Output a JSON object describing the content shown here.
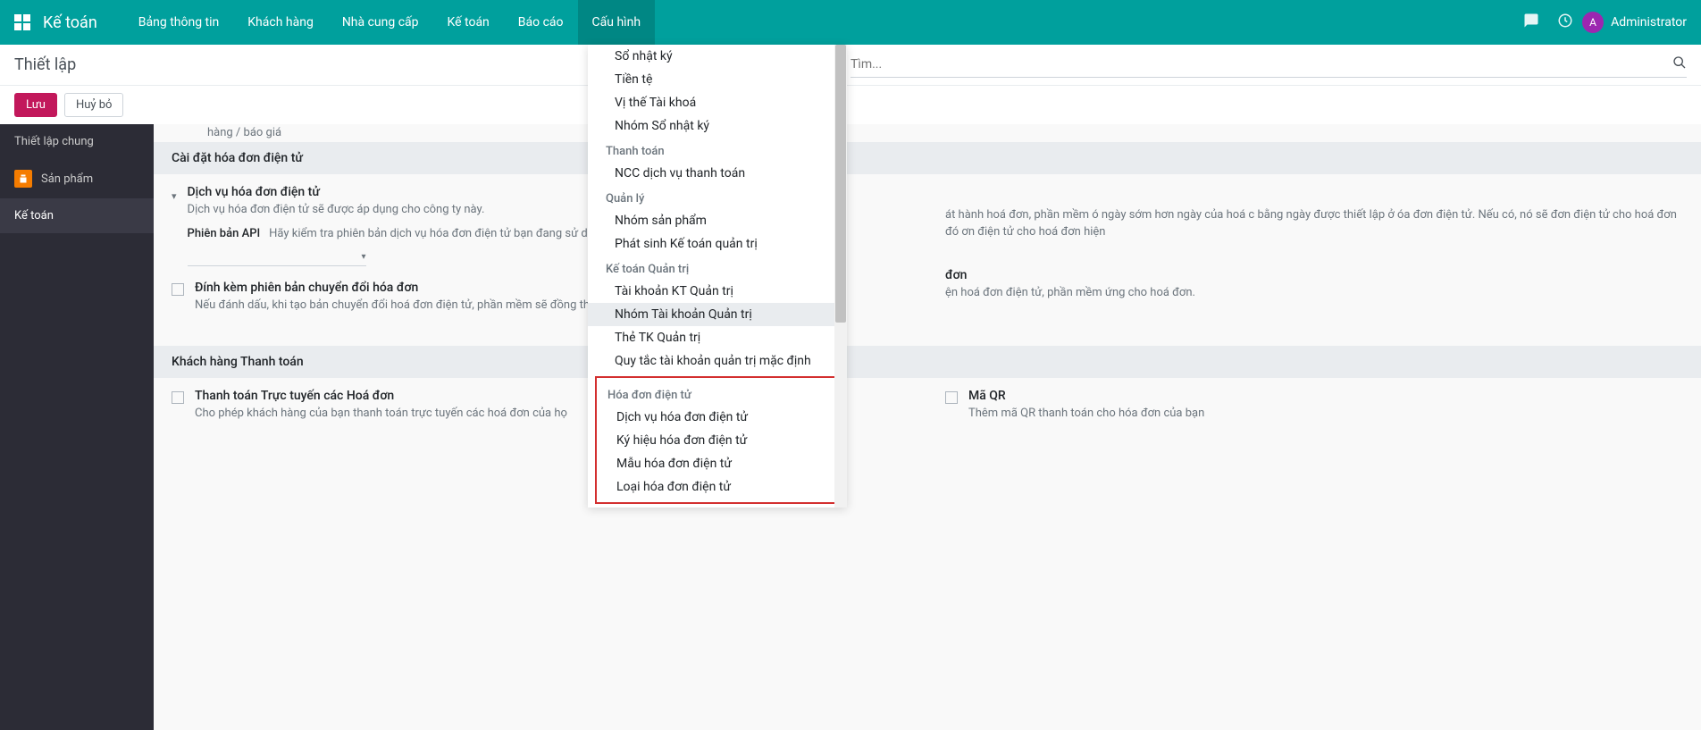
{
  "topbar": {
    "app_name": "Kế toán",
    "nav": [
      "Bảng thông tin",
      "Khách hàng",
      "Nhà cung cấp",
      "Kế toán",
      "Báo cáo",
      "Cấu hình"
    ],
    "user_initial": "A",
    "user_name": "Administrator"
  },
  "page": {
    "title": "Thiết lập",
    "search_placeholder": "Tìm...",
    "save_label": "Lưu",
    "discard_label": "Huỷ bỏ"
  },
  "sidebar": {
    "items": [
      {
        "label": "Thiết lập chung",
        "icon": ""
      },
      {
        "label": "Sản phẩm",
        "icon": "$"
      },
      {
        "label": "Kế toán",
        "icon": ""
      }
    ]
  },
  "content": {
    "truncated_top": "hàng / báo giá",
    "section1_title": "Cài đặt hóa đơn điện tử",
    "service_label": "Dịch vụ hóa đơn điện tử",
    "service_desc": "Dịch vụ hóa đơn điện tử sẽ được áp dụng cho công ty này.",
    "api_label": "Phiên bản API",
    "api_desc": "Hãy kiểm tra phiên bản dịch vụ hóa đơn điện tử bạn đang sử dụng trước khi thiết lập ở đây.",
    "attach_label": "Đính kèm phiên bản chuyển đổi hóa đơn",
    "attach_desc": "Nếu đánh dấu, khi tạo bản chuyển đổi hoá đơn điện tử, phần mềm sẽ đồng thời tạo đính kèm tương ứng cho hoá đơn.",
    "right_block1": "át hành hoá đơn, phần mềm ó ngày sớm hơn ngày của hoá c bằng ngày được thiết lập ở óa đơn điện tử. Nếu có, nó sẽ đơn điện tử cho hoá đơn đó ơn điện tử cho hoá đơn hiện",
    "right_label2": "đơn",
    "right_block2": "ện hoá đơn điện tử, phần mềm ứng cho hoá đơn.",
    "section2_title": "Khách hàng Thanh toán",
    "pay_label": "Thanh toán Trực tuyến các Hoá đơn",
    "pay_desc": "Cho phép khách hàng của bạn thanh toán trực tuyến các hoá đơn của họ",
    "qr_label": "Mã QR",
    "qr_desc": "Thêm mã QR thanh toán cho hóa đơn của bạn"
  },
  "dropdown": {
    "items_top": [
      "Sổ nhật ký",
      "Tiền tệ",
      "Vị thế Tài khoá",
      "Nhóm Sổ nhật ký"
    ],
    "group_pay_header": "Thanh toán",
    "group_pay_items": [
      "NCC dịch vụ thanh toán"
    ],
    "group_mgmt_header": "Quản lý",
    "group_mgmt_items": [
      "Nhóm sản phẩm",
      "Phát sinh Kế toán quản trị"
    ],
    "group_macc_header": "Kế toán Quản trị",
    "group_macc_items": [
      "Tài khoản KT Quản trị",
      "Nhóm Tài khoản Quản trị",
      "Thẻ TK Quản trị",
      "Quy tắc tài khoản quản trị mặc định"
    ],
    "group_einv_header": "Hóa đơn điện tử",
    "group_einv_items": [
      "Dịch vụ hóa đơn điện tử",
      "Ký hiệu hóa đơn điện tử",
      "Mẫu hóa đơn điện tử",
      "Loại hóa đơn điện tử"
    ]
  }
}
